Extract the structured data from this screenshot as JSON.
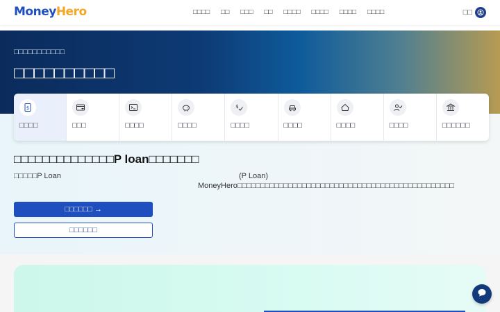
{
  "header": {
    "logo_money": "Money",
    "logo_hero": "Hero",
    "nav": [
      "□□□□",
      "□□",
      "□□□",
      "□□",
      "□□□□",
      "□□□□",
      "□□□□",
      "□□□□"
    ],
    "login_label": "□□"
  },
  "hero": {
    "subtitle": "□□□□□□□□□□□",
    "title": "□□□□□□□□□□"
  },
  "categories": [
    {
      "label": "□□□□",
      "icon": "loan-document-icon"
    },
    {
      "label": "□□□",
      "icon": "credit-card-icon"
    },
    {
      "label": "□□□□",
      "icon": "terminal-icon"
    },
    {
      "label": "□□□□",
      "icon": "piggy-bank-icon"
    },
    {
      "label": "□□□□",
      "icon": "money-check-icon"
    },
    {
      "label": "□□□□",
      "icon": "car-icon"
    },
    {
      "label": "□□□□",
      "icon": "home-icon"
    },
    {
      "label": "□□□□",
      "icon": "user-check-icon"
    },
    {
      "label": "□□□□□□",
      "icon": "bank-icon"
    }
  ],
  "content": {
    "section_title": "□□□□□□□□□□□□□□P loan□□□□□□□",
    "desc_line1_left": "□□□□□P Loan",
    "desc_line1_right": "(P Loan)",
    "desc_line2": "MoneyHero□□□□□□□□□□□□□□□□□□□□□□□□□□□□□□□□□□□□□□□□□□□□□□□",
    "primary_button": "□□□□□□ →",
    "secondary_button": "□□□□□□"
  },
  "colors": {
    "brand_blue": "#1f4fbf",
    "brand_orange": "#f5a623",
    "hero_dark": "#0b2b5c",
    "mint": "#ccf7ea"
  }
}
